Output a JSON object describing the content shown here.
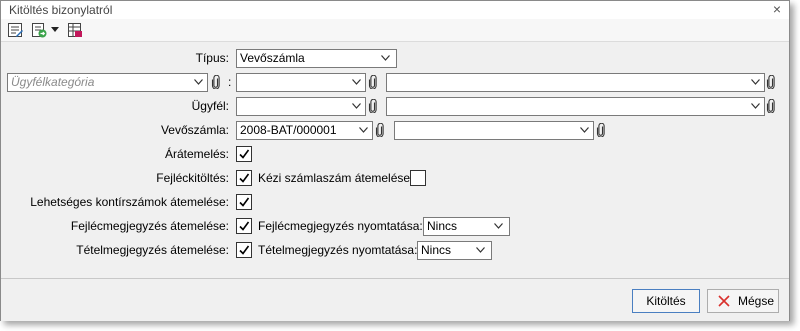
{
  "window": {
    "title": "Kitöltés bizonylatról",
    "close_glyph": "×"
  },
  "toolbar": {
    "icons": [
      "edit-form-icon",
      "fill-document-icon",
      "dropdown-arrow-icon",
      "table-check-icon"
    ]
  },
  "form": {
    "tipus_label": "Típus:",
    "tipus_value": "Vevőszámla",
    "ugyfelkategoria_placeholder": "Ügyfélkategória",
    "colon": ":",
    "ugyfel_label": "Ügyfél:",
    "vevoszamla_label": "Vevőszámla:",
    "vevoszamla_value": "2008-BAT/000001",
    "aratemeles_label": "Árátemelés:",
    "aratemeles_checked": true,
    "fejleckitoltes_label": "Fejléckitöltés:",
    "fejleckitoltes_checked": true,
    "kezi_label": "Kézi számlaszám átemelése:",
    "kezi_checked": false,
    "kontir_label": "Lehetséges kontírszámok átemelése:",
    "kontir_checked": true,
    "fejlecmegj_label": "Fejlécmegjegyzés átemelése:",
    "fejlecmegj_checked": true,
    "fejlecny_label": "Fejlécmegjegyzés nyomtatása:",
    "fejlecny_value": "Nincs",
    "tetelmegj_label": "Tételmegjegyzés átemelése:",
    "tetelmegj_checked": true,
    "tetelny_label": "Tételmegjegyzés nyomtatása:",
    "tetelny_value": "Nincs"
  },
  "footer": {
    "ok_label": "Kitöltés",
    "cancel_label": "Mégse"
  },
  "colors": {
    "accent_border": "#4a7fc1",
    "cancel_icon": "#d9302c"
  }
}
